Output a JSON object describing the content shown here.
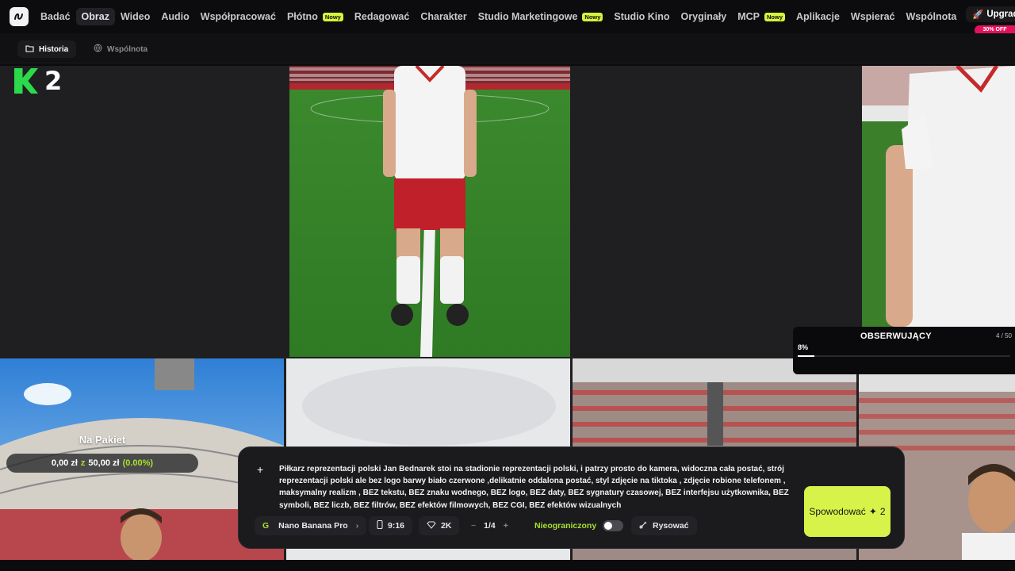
{
  "nav": {
    "logo_icon": "app-logo-icon",
    "items": [
      {
        "label": "Badać",
        "active": false,
        "new": false
      },
      {
        "label": "Obraz",
        "active": true,
        "new": false
      },
      {
        "label": "Wideo",
        "active": false,
        "new": false
      },
      {
        "label": "Audio",
        "active": false,
        "new": false
      },
      {
        "label": "Współpracować",
        "active": false,
        "new": false
      },
      {
        "label": "Płótno",
        "active": false,
        "new": true
      },
      {
        "label": "Redagować",
        "active": false,
        "new": false
      },
      {
        "label": "Charakter",
        "active": false,
        "new": false
      },
      {
        "label": "Studio Marketingowe",
        "active": false,
        "new": true
      },
      {
        "label": "Studio Kino",
        "active": false,
        "new": false
      },
      {
        "label": "Oryginały",
        "active": false,
        "new": false
      },
      {
        "label": "MCP",
        "active": false,
        "new": true
      },
      {
        "label": "Aplikacje",
        "active": false,
        "new": false
      },
      {
        "label": "Wspierać",
        "active": false,
        "new": false
      },
      {
        "label": "Wspólnota",
        "active": false,
        "new": false
      }
    ],
    "new_badge": "Nowy",
    "upgrade_label": "Upgrade",
    "discount_label": "30% OFF"
  },
  "subnav": {
    "history_label": "Historia",
    "community_label": "Wspólnota"
  },
  "k2": {
    "label": "2"
  },
  "follow": {
    "title": "OBSERWUJĄCY",
    "count": "4 / 50",
    "percent": "8%",
    "progress": 0.08
  },
  "pakiet": {
    "title": "Na Pakiet",
    "amount": "0,00 zł",
    "of": "z",
    "total": "50,00 zł",
    "percent": "(0.00%)"
  },
  "prompt": {
    "text": "Piłkarz reprezentacji polski Jan Bednarek  stoi na stadionie reprezentacji polski, i patrzy prosto do kamera, widoczna cała postać, strój reprezentacji polski ale bez logo barwy biało czerwone ,delikatnie oddalona postać, styl zdjęcie na tiktoka , zdjęcie robione telefonem , maksymalny realizm , BEZ tekstu, BEZ znaku wodnego, BEZ logo, BEZ daty, BEZ sygnatury czasowej, BEZ interfejsu użytkownika, BEZ symboli, BEZ liczb, BEZ filtrów, BEZ efektów filmowych, BEZ CGI, BEZ efektów wizualnych",
    "model": "Nano Banana Pro",
    "ratio": "9:16",
    "quality": "2K",
    "count": "1/4",
    "unlimited_label": "Nieograniczony",
    "draw_label": "Rysować",
    "generate_label": "Spowodować",
    "generate_cost": "2"
  },
  "colors": {
    "accent_lime": "#d7f34a",
    "accent_green": "#a6e22e",
    "discount_pink": "#e2135d"
  }
}
